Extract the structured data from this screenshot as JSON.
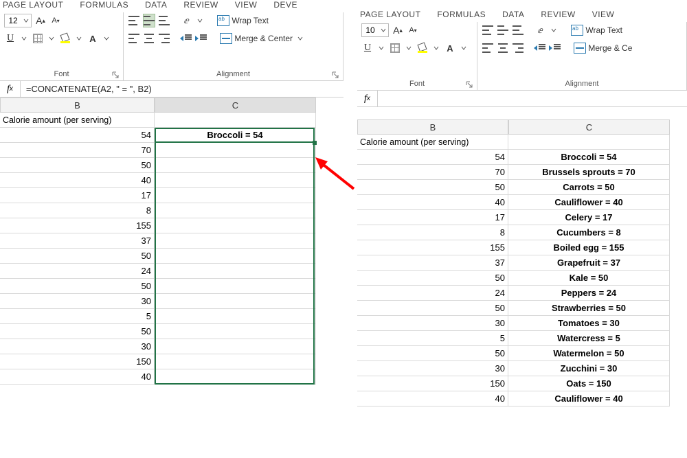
{
  "ribbon_tabs": [
    "PAGE LAYOUT",
    "FORMULAS",
    "DATA",
    "REVIEW",
    "VIEW",
    "DEVE"
  ],
  "ribbon_tabs_right": [
    "PAGE LAYOUT",
    "FORMULAS",
    "DATA",
    "REVIEW",
    "VIEW"
  ],
  "font": {
    "size_left": "12",
    "size_right": "10",
    "underline": "U",
    "fontA": "A",
    "group_label": "Font",
    "fill_color": "#ffff00",
    "text_color": "#ff0000"
  },
  "alignment": {
    "wrap": "Wrap Text",
    "merge": "Merge & Center",
    "merge_right": "Merge & Ce",
    "group_label": "Alignment"
  },
  "formula_left": "=CONCATENATE(A2, \" = \", B2)",
  "formula_right": "",
  "headers": {
    "B": "B",
    "C": "C",
    "calorie": "Calorie amount (per serving)"
  },
  "left": {
    "b": [
      "54",
      "70",
      "50",
      "40",
      "17",
      "8",
      "155",
      "37",
      "50",
      "24",
      "50",
      "30",
      "5",
      "50",
      "30",
      "150",
      "40"
    ],
    "c_first": "Broccoli = 54"
  },
  "right": {
    "b": [
      "54",
      "70",
      "50",
      "40",
      "17",
      "8",
      "155",
      "37",
      "50",
      "24",
      "50",
      "30",
      "5",
      "50",
      "30",
      "150",
      "40"
    ],
    "c": [
      "Broccoli = 54",
      "Brussels sprouts = 70",
      "Carrots = 50",
      "Cauliflower = 40",
      "Celery = 17",
      "Cucumbers = 8",
      "Boiled egg = 155",
      "Grapefruit = 37",
      "Kale = 50",
      "Peppers = 24",
      "Strawberries = 50",
      "Tomatoes = 30",
      "Watercress = 5",
      "Watermelon = 50",
      "Zucchini = 30",
      "Oats = 150",
      "Cauliflower = 40"
    ]
  }
}
